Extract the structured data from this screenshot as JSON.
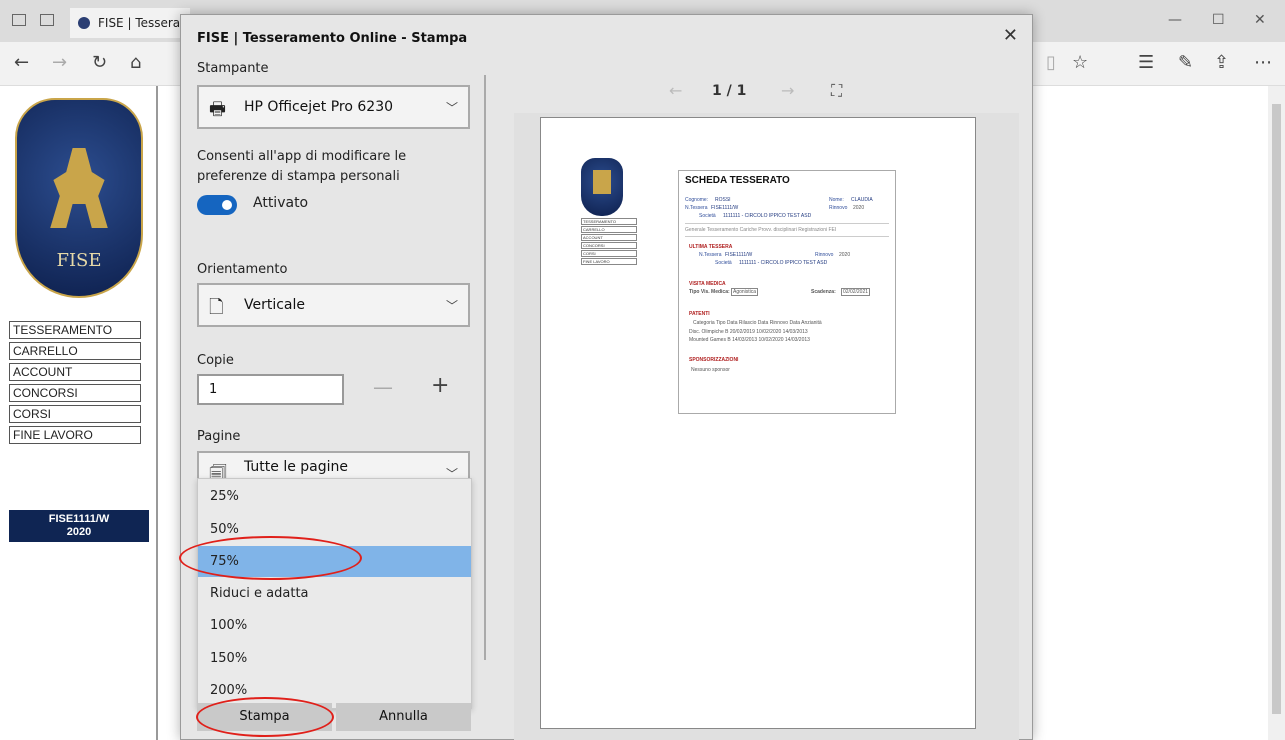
{
  "browser": {
    "tab_title": "FISE | Tesseram",
    "window_controls": [
      "—",
      "☐",
      "✕"
    ],
    "nav_icons": [
      "back-icon",
      "forward-icon",
      "refresh-icon",
      "home-icon",
      "reading-view-icon",
      "favorite-icon",
      "favorites-icon",
      "pen-icon",
      "share-icon",
      "more-icon"
    ]
  },
  "page": {
    "logo_text": "FISE",
    "menu": [
      "TESSERAMENTO",
      "CARRELLO",
      "ACCOUNT",
      "CONCORSI",
      "CORSI",
      "FINE LAVORO"
    ],
    "badge_line1": "FISE1111/W",
    "badge_line2": "2020"
  },
  "dialog": {
    "title": "FISE | Tesseramento Online - Stampa",
    "printer_label": "Stampante",
    "printer_value": "HP Officejet Pro 6230",
    "consent_text": "Consenti all'app di modificare le preferenze di stampa personali",
    "toggle_label": "Attivato",
    "orientation_label": "Orientamento",
    "orientation_value": "Verticale",
    "copies_label": "Copie",
    "copies_value": "1",
    "copies_minus": "—",
    "copies_plus": "+",
    "pages_label": "Pagine",
    "pages_value": "Tutte le pagine",
    "scale_options": [
      "25%",
      "50%",
      "75%",
      "Riduci e adatta",
      "100%",
      "150%",
      "200%"
    ],
    "selected_scale": "75%",
    "print_button": "Stampa",
    "cancel_button": "Annulla"
  },
  "preview": {
    "page_count": "1 / 1",
    "mini_menu": [
      "TESSERAMENTO",
      "CARRELLO",
      "ACCOUNT",
      "CONCORSI",
      "CORSI",
      "FINE LAVORO"
    ],
    "card": {
      "title": "SCHEDA TESSERATO",
      "cognome_label": "Cognome:",
      "cognome": "ROSSI",
      "nome_label": "Nome:",
      "nome": "CLAUDIA",
      "tessera_label": "N.Tessera",
      "tessera": "FISE1111/W",
      "rinnovo_label": "Rinnovo",
      "rinnovo": "2020",
      "societa_label": "Società",
      "societa": "1111111 - CIRCOLO IPPICO TEST ASD",
      "tabs": "Generale   Tesseramento   Cariche   Provv. disciplinari   Registrazioni FEI",
      "ultima_tessera": "ULTIMA TESSERA",
      "tessera2": "FISE1111/W",
      "rinnovo2": "2020",
      "societa2": "1111111 - CIRCOLO IPPICO TEST ASD",
      "visita": "VISITA MEDICA",
      "tipo_visita_label": "Tipo Vis. Medica:",
      "tipo_visita": "Agonistica",
      "scadenza_label": "Scadenza:",
      "scadenza": "02/02/2021",
      "patenti": "PATENTI",
      "patenti_header": "Categoria    Tipo   Data Rilascio   Data Rinnovo   Data Anzianità",
      "patenti_row1": "Disc. Olimpiche   B     20/02/2019     10/02/2020     14/03/2013",
      "patenti_row2": "Mounted Games   B     14/03/2013     10/02/2020     14/03/2013",
      "sponsor": "SPONSORIZZAZIONI",
      "sponsor_value": "Nessuno sponsor"
    }
  }
}
